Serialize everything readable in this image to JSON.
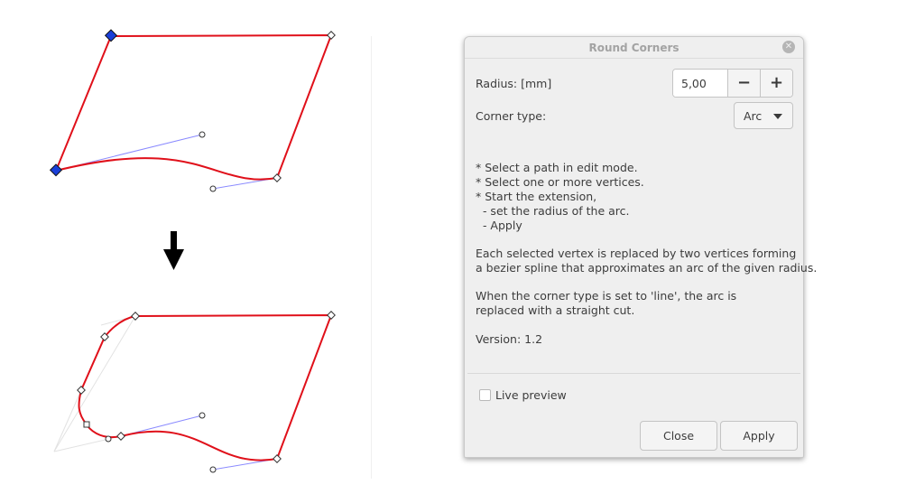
{
  "dialog": {
    "title": "Round Corners",
    "radius_label": "Radius: [mm]",
    "radius_value": "5,00",
    "minus_label": "−",
    "plus_label": "+",
    "corner_type_label": "Corner type:",
    "corner_type_value": "Arc",
    "help_block_1": "* Select a path in edit mode.\n* Select one or more vertices.\n* Start the extension,\n  - set the radius of the arc.\n  - Apply",
    "help_block_2": "Each selected vertex is replaced by two vertices forming\na bezier spline that approximates an arc of the given radius.",
    "help_block_3": "When the corner type is set to 'line', the arc is\nreplaced with a straight cut.",
    "version": "Version: 1.2",
    "live_preview_label": "Live preview",
    "live_preview_checked": false,
    "close_label": "Close",
    "apply_label": "Apply"
  },
  "colors": {
    "path_stroke": "#e0101a",
    "handle_line": "#8080ff",
    "selected_node": "#1a3fd8",
    "arrow": "#000000"
  }
}
